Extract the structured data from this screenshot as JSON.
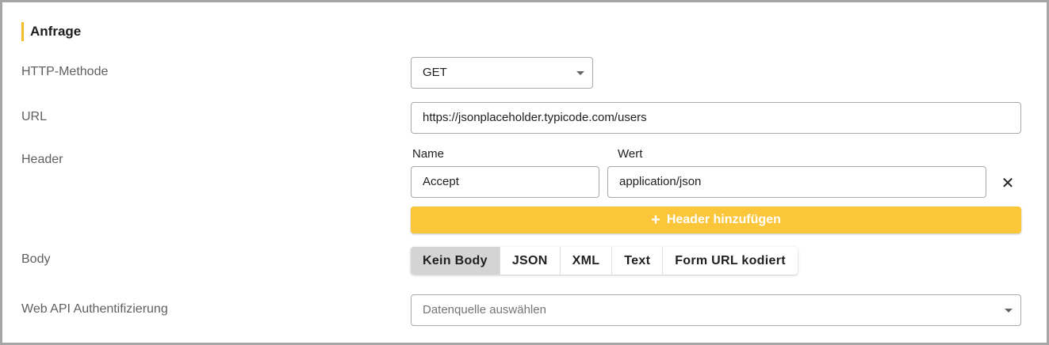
{
  "section": {
    "title": "Anfrage"
  },
  "http_method": {
    "label": "HTTP-Methode",
    "value": "GET"
  },
  "url": {
    "label": "URL",
    "value": "https://jsonplaceholder.typicode.com/users"
  },
  "headers": {
    "label": "Header",
    "name_column": "Name",
    "value_column": "Wert",
    "rows": [
      {
        "name": "Accept",
        "value": "application/json"
      }
    ],
    "remove_symbol": "✕",
    "add_button": {
      "icon": "+",
      "label": "Header hinzufügen"
    }
  },
  "body": {
    "label": "Body",
    "options": [
      "Kein Body",
      "JSON",
      "XML",
      "Text",
      "Form URL kodiert"
    ],
    "selected": "Kein Body"
  },
  "auth": {
    "label": "Web API Authentifizierung",
    "placeholder": "Datenquelle auswählen"
  },
  "colors": {
    "accent": "#f4bf2a",
    "button": "#fcc63a",
    "active_segment": "#d4d4d4"
  }
}
